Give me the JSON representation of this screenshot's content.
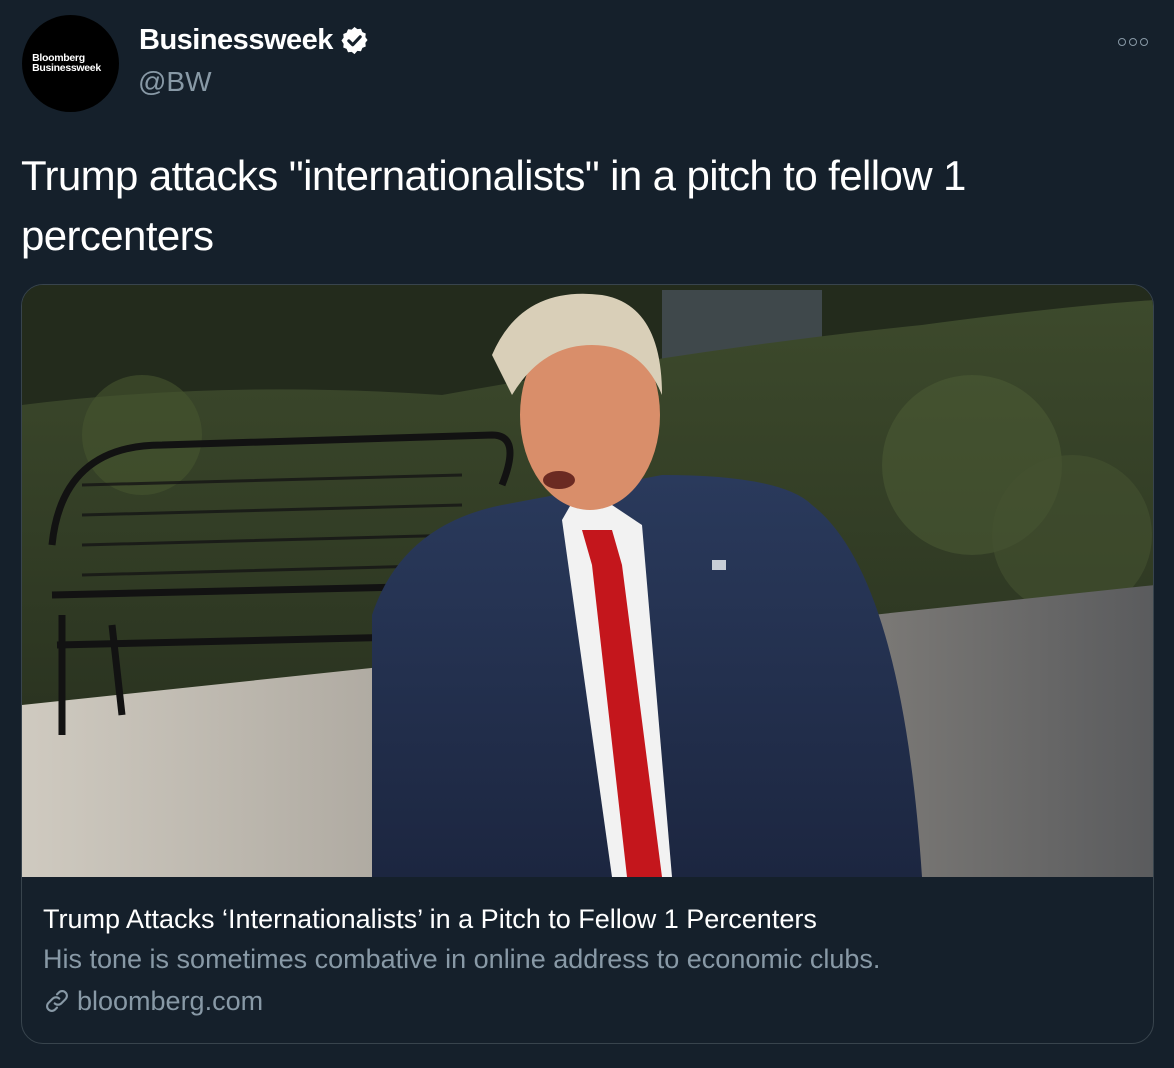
{
  "account": {
    "avatar_logo": [
      "Bloomberg",
      "Businessweek"
    ],
    "display_name": "Businessweek",
    "handle": "@BW",
    "verified_icon": "verified-badge-icon",
    "more_icon": "more-options-icon"
  },
  "tweet": {
    "text": "Trump attacks \"internationalists\" in a pitch to fellow 1 percenters"
  },
  "card": {
    "image_description": "photo",
    "title": "Trump Attacks ‘Internationalists’ in a Pitch to Fellow 1 Percenters",
    "description": "His tone is sometimes combative in online address to economic clubs.",
    "domain": "bloomberg.com",
    "domain_icon": "link-icon"
  },
  "colors": {
    "background": "#15202b",
    "text_primary": "#ffffff",
    "text_secondary": "#8899a6",
    "border": "#38444d"
  }
}
